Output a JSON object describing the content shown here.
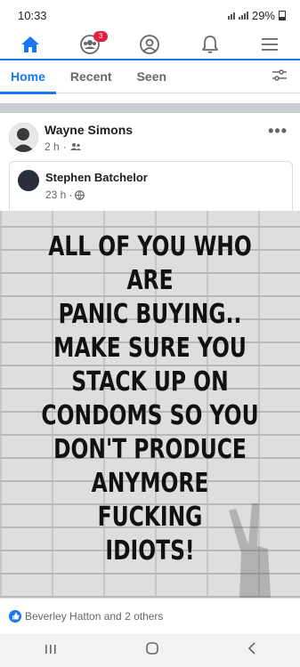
{
  "status_bar": {
    "time": "10:33",
    "battery": "29%"
  },
  "tabs": {
    "home_label": "Home",
    "recent_label": "Recent",
    "seen_label": "Seen"
  },
  "nav": {
    "groups_badge": "3"
  },
  "post": {
    "author": "Wayne Simons",
    "time": "2 h",
    "shared": {
      "author": "Stephen Batchelor",
      "time": "23 h"
    },
    "meme_lines": [
      "ALL OF YOU WHO ARE",
      "PANIC BUYING..",
      "MAKE SURE YOU",
      "STACK UP ON",
      "CONDOMS SO YOU",
      "DON'T PRODUCE",
      "ANYMORE FUCKING",
      "IDIOTS!"
    ],
    "reactions_text": "Beverley Hatton and 2 others"
  },
  "colors": {
    "accent": "#1877f2",
    "badge": "#e41e3f",
    "separator": "#c9ccd1"
  },
  "icons": [
    "home-icon",
    "groups-icon",
    "profile-icon",
    "bell-icon",
    "menu-icon",
    "filter-icon",
    "friends-audience-icon",
    "globe-icon",
    "like-icon"
  ]
}
